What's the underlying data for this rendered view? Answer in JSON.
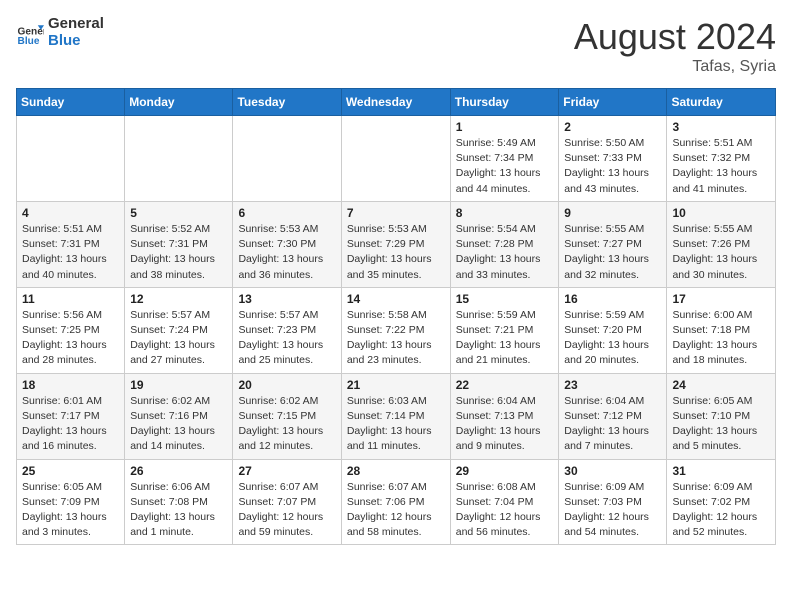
{
  "header": {
    "logo_line1": "General",
    "logo_line2": "Blue",
    "month": "August 2024",
    "location": "Tafas, Syria"
  },
  "weekdays": [
    "Sunday",
    "Monday",
    "Tuesday",
    "Wednesday",
    "Thursday",
    "Friday",
    "Saturday"
  ],
  "weeks": [
    [
      {
        "day": "",
        "info": ""
      },
      {
        "day": "",
        "info": ""
      },
      {
        "day": "",
        "info": ""
      },
      {
        "day": "",
        "info": ""
      },
      {
        "day": "1",
        "info": "Sunrise: 5:49 AM\nSunset: 7:34 PM\nDaylight: 13 hours\nand 44 minutes."
      },
      {
        "day": "2",
        "info": "Sunrise: 5:50 AM\nSunset: 7:33 PM\nDaylight: 13 hours\nand 43 minutes."
      },
      {
        "day": "3",
        "info": "Sunrise: 5:51 AM\nSunset: 7:32 PM\nDaylight: 13 hours\nand 41 minutes."
      }
    ],
    [
      {
        "day": "4",
        "info": "Sunrise: 5:51 AM\nSunset: 7:31 PM\nDaylight: 13 hours\nand 40 minutes."
      },
      {
        "day": "5",
        "info": "Sunrise: 5:52 AM\nSunset: 7:31 PM\nDaylight: 13 hours\nand 38 minutes."
      },
      {
        "day": "6",
        "info": "Sunrise: 5:53 AM\nSunset: 7:30 PM\nDaylight: 13 hours\nand 36 minutes."
      },
      {
        "day": "7",
        "info": "Sunrise: 5:53 AM\nSunset: 7:29 PM\nDaylight: 13 hours\nand 35 minutes."
      },
      {
        "day": "8",
        "info": "Sunrise: 5:54 AM\nSunset: 7:28 PM\nDaylight: 13 hours\nand 33 minutes."
      },
      {
        "day": "9",
        "info": "Sunrise: 5:55 AM\nSunset: 7:27 PM\nDaylight: 13 hours\nand 32 minutes."
      },
      {
        "day": "10",
        "info": "Sunrise: 5:55 AM\nSunset: 7:26 PM\nDaylight: 13 hours\nand 30 minutes."
      }
    ],
    [
      {
        "day": "11",
        "info": "Sunrise: 5:56 AM\nSunset: 7:25 PM\nDaylight: 13 hours\nand 28 minutes."
      },
      {
        "day": "12",
        "info": "Sunrise: 5:57 AM\nSunset: 7:24 PM\nDaylight: 13 hours\nand 27 minutes."
      },
      {
        "day": "13",
        "info": "Sunrise: 5:57 AM\nSunset: 7:23 PM\nDaylight: 13 hours\nand 25 minutes."
      },
      {
        "day": "14",
        "info": "Sunrise: 5:58 AM\nSunset: 7:22 PM\nDaylight: 13 hours\nand 23 minutes."
      },
      {
        "day": "15",
        "info": "Sunrise: 5:59 AM\nSunset: 7:21 PM\nDaylight: 13 hours\nand 21 minutes."
      },
      {
        "day": "16",
        "info": "Sunrise: 5:59 AM\nSunset: 7:20 PM\nDaylight: 13 hours\nand 20 minutes."
      },
      {
        "day": "17",
        "info": "Sunrise: 6:00 AM\nSunset: 7:18 PM\nDaylight: 13 hours\nand 18 minutes."
      }
    ],
    [
      {
        "day": "18",
        "info": "Sunrise: 6:01 AM\nSunset: 7:17 PM\nDaylight: 13 hours\nand 16 minutes."
      },
      {
        "day": "19",
        "info": "Sunrise: 6:02 AM\nSunset: 7:16 PM\nDaylight: 13 hours\nand 14 minutes."
      },
      {
        "day": "20",
        "info": "Sunrise: 6:02 AM\nSunset: 7:15 PM\nDaylight: 13 hours\nand 12 minutes."
      },
      {
        "day": "21",
        "info": "Sunrise: 6:03 AM\nSunset: 7:14 PM\nDaylight: 13 hours\nand 11 minutes."
      },
      {
        "day": "22",
        "info": "Sunrise: 6:04 AM\nSunset: 7:13 PM\nDaylight: 13 hours\nand 9 minutes."
      },
      {
        "day": "23",
        "info": "Sunrise: 6:04 AM\nSunset: 7:12 PM\nDaylight: 13 hours\nand 7 minutes."
      },
      {
        "day": "24",
        "info": "Sunrise: 6:05 AM\nSunset: 7:10 PM\nDaylight: 13 hours\nand 5 minutes."
      }
    ],
    [
      {
        "day": "25",
        "info": "Sunrise: 6:05 AM\nSunset: 7:09 PM\nDaylight: 13 hours\nand 3 minutes."
      },
      {
        "day": "26",
        "info": "Sunrise: 6:06 AM\nSunset: 7:08 PM\nDaylight: 13 hours\nand 1 minute."
      },
      {
        "day": "27",
        "info": "Sunrise: 6:07 AM\nSunset: 7:07 PM\nDaylight: 12 hours\nand 59 minutes."
      },
      {
        "day": "28",
        "info": "Sunrise: 6:07 AM\nSunset: 7:06 PM\nDaylight: 12 hours\nand 58 minutes."
      },
      {
        "day": "29",
        "info": "Sunrise: 6:08 AM\nSunset: 7:04 PM\nDaylight: 12 hours\nand 56 minutes."
      },
      {
        "day": "30",
        "info": "Sunrise: 6:09 AM\nSunset: 7:03 PM\nDaylight: 12 hours\nand 54 minutes."
      },
      {
        "day": "31",
        "info": "Sunrise: 6:09 AM\nSunset: 7:02 PM\nDaylight: 12 hours\nand 52 minutes."
      }
    ]
  ]
}
